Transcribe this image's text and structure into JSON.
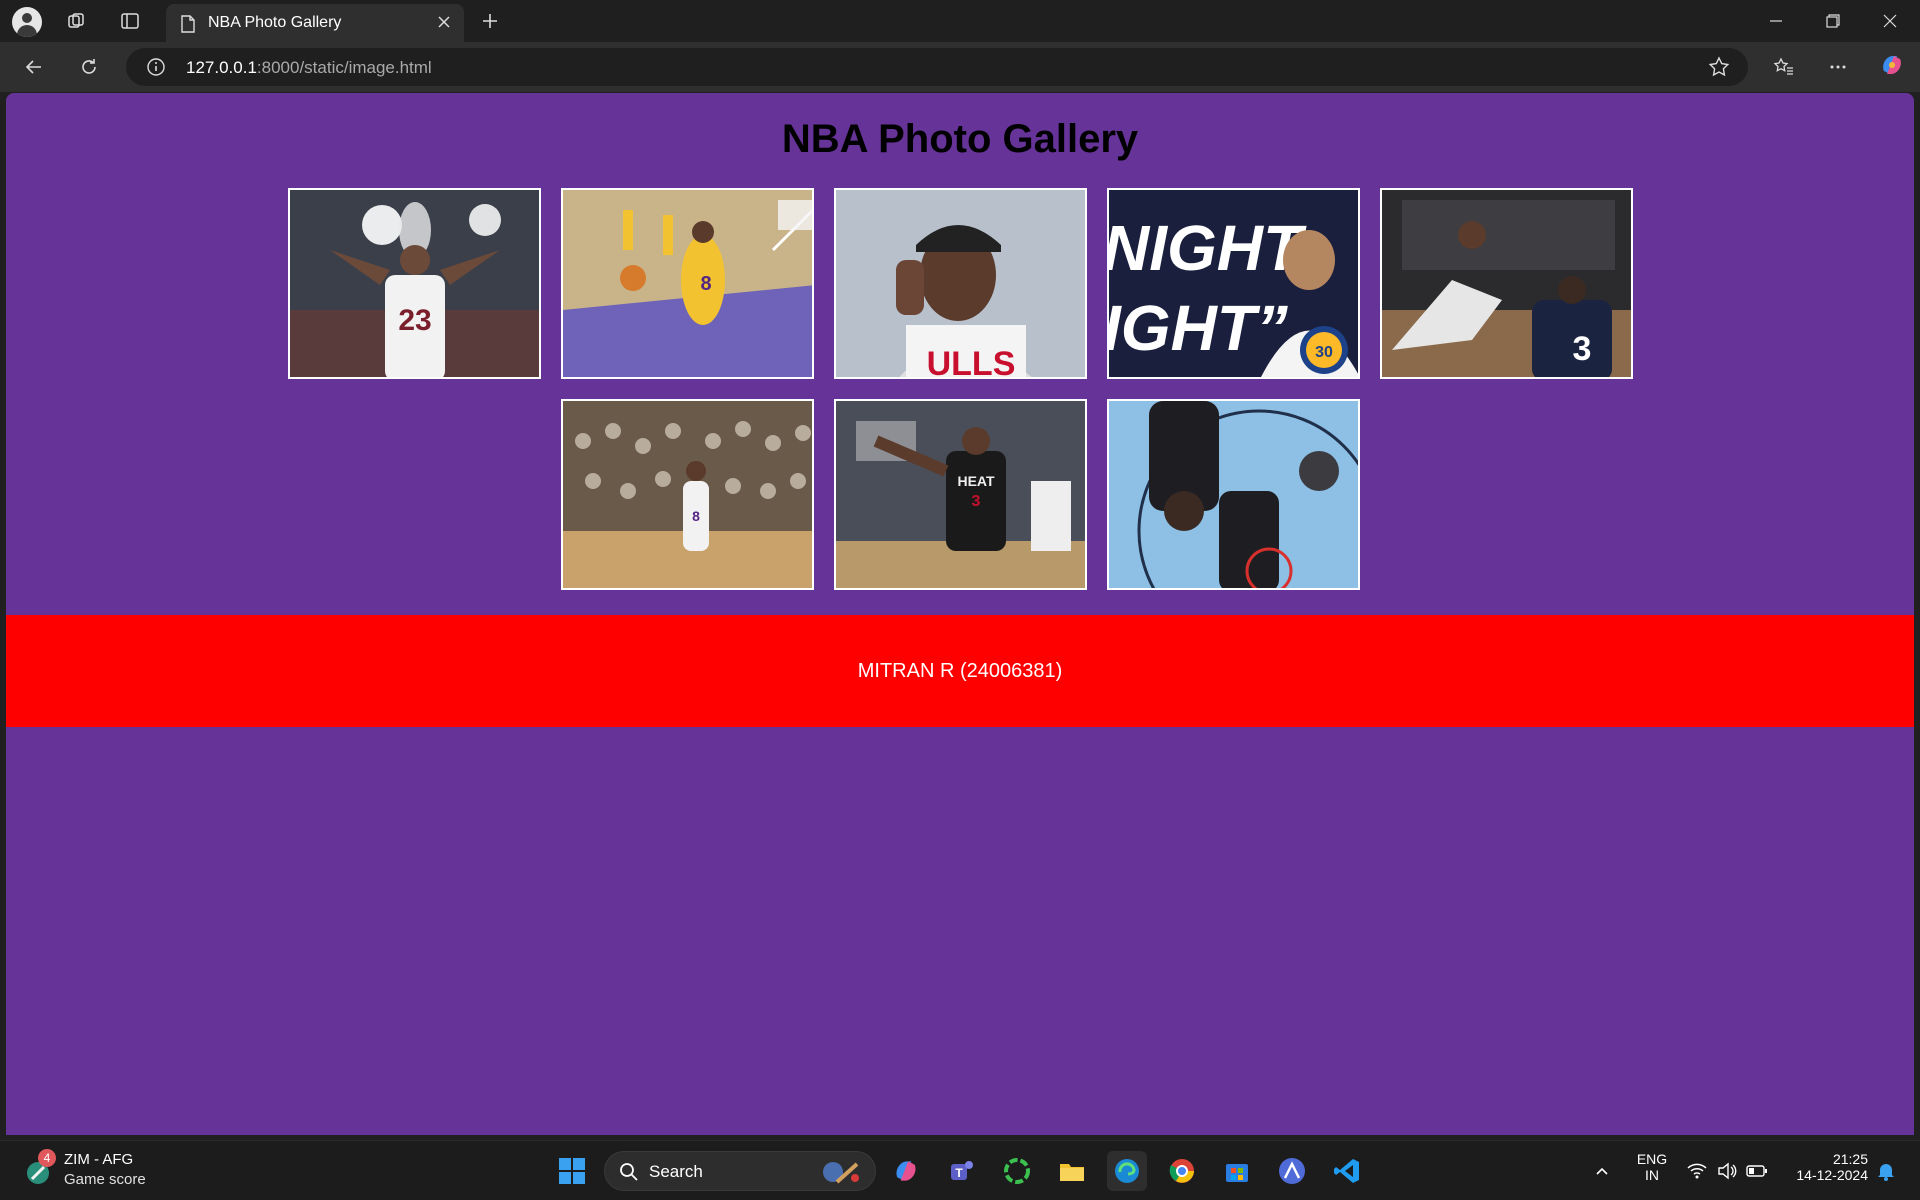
{
  "browser": {
    "tab_title": "NBA Photo Gallery",
    "url_host": "127.0.0.1",
    "url_rest": ":8000/static/image.html"
  },
  "page": {
    "title": "NBA Photo Gallery",
    "footer_text": "MITRAN R (24006381)",
    "background_color": "#663399",
    "footer_color": "#ff0000"
  },
  "gallery": {
    "photos": [
      {
        "name": "photo-lebron",
        "caption": ""
      },
      {
        "name": "photo-kobe-dunk",
        "caption": ""
      },
      {
        "name": "photo-jordan",
        "caption": ""
      },
      {
        "name": "photo-curry",
        "caption": "NIGHT NIGHT\""
      },
      {
        "name": "photo-kyrie-iverson",
        "caption": ""
      },
      {
        "name": "photo-kobe-crowd",
        "caption": ""
      },
      {
        "name": "photo-wade",
        "caption": ""
      },
      {
        "name": "photo-overhead",
        "caption": ""
      }
    ]
  },
  "taskbar": {
    "weather_badge": "4",
    "weather_line1": "ZIM - AFG",
    "weather_line2": "Game score",
    "search_label": "Search",
    "lang_line1": "ENG",
    "lang_line2": "IN",
    "time": "21:25",
    "date": "14-12-2024"
  }
}
